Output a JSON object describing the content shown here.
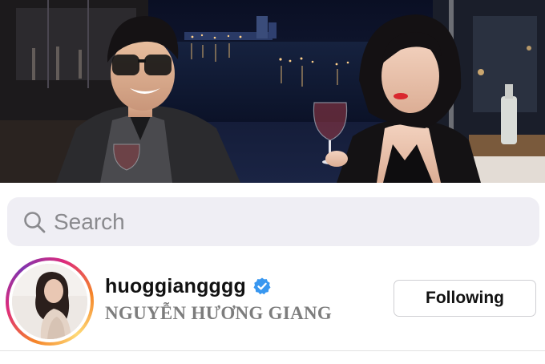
{
  "search": {
    "placeholder": "Search"
  },
  "profile": {
    "username": "huoggiangggg",
    "display_name": "NGUYỄN HƯƠNG GIANG",
    "verified": true,
    "follow_button_label": "Following"
  },
  "icons": {
    "search": "search-icon",
    "verified": "verified-badge-icon"
  },
  "colors": {
    "search_bg": "#efeef4",
    "verified_blue": "#3897f0",
    "story_ring": [
      "#f58529",
      "#dd2a7b",
      "#8134af",
      "#feda77"
    ]
  }
}
